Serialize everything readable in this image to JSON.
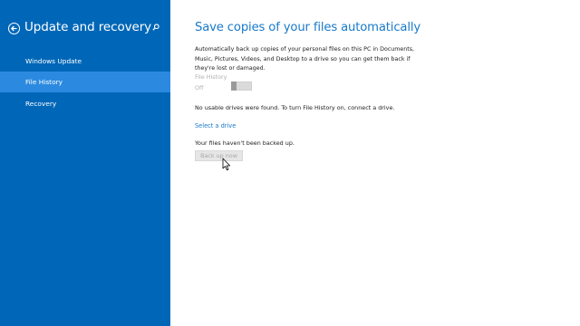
{
  "sidebar": {
    "title": "Update and recovery",
    "back_icon": "back-arrow-circle-icon",
    "search_icon": "search-icon",
    "items": [
      {
        "label": "Windows Update",
        "selected": false
      },
      {
        "label": "File History",
        "selected": true
      },
      {
        "label": "Recovery",
        "selected": false
      }
    ]
  },
  "main": {
    "title": "Save copies of your files automatically",
    "description": "Automatically back up copies of your personal files on this PC in Documents, Music, Pictures, Videos, and Desktop to a drive so you can get them back if they're lost or damaged.",
    "file_history": {
      "label": "File History",
      "state": "Off"
    },
    "no_drives_message": "No usable drives were found. To turn File History on, connect a drive.",
    "select_drive_link": "Select a drive",
    "backup_status": "Your files haven't been backed up.",
    "backup_button": "Back up now"
  },
  "colors": {
    "sidebar_bg": "#0067b8",
    "selected_item_bg": "#2b8ae0",
    "accent": "#1979ca"
  }
}
